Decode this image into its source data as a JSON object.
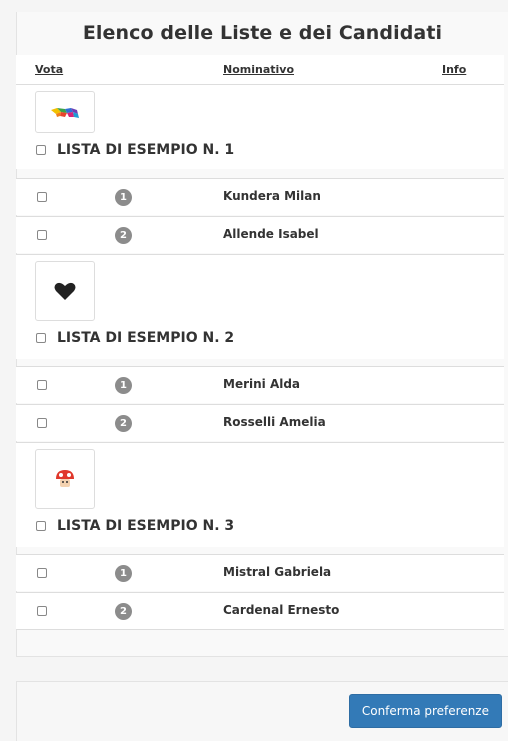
{
  "page": {
    "title": "Elenco delle Liste e dei Candidati"
  },
  "table": {
    "headers": {
      "vote": "Vota",
      "name": "Nominativo",
      "info": "Info"
    }
  },
  "lists": [
    {
      "title": "LISTA DI ESEMPIO N. 1",
      "logo_icon": "rainbow-horse-icon",
      "candidates": [
        {
          "number": "1",
          "name": "Kundera Milan"
        },
        {
          "number": "2",
          "name": "Allende Isabel"
        }
      ]
    },
    {
      "title": "LISTA DI ESEMPIO N. 2",
      "logo_icon": "black-heart-icon",
      "candidates": [
        {
          "number": "1",
          "name": "Merini Alda"
        },
        {
          "number": "2",
          "name": "Rosselli Amelia"
        }
      ]
    },
    {
      "title": "LISTA DI ESEMPIO N. 3",
      "logo_icon": "red-mushroom-icon",
      "candidates": [
        {
          "number": "1",
          "name": "Mistral Gabriela"
        },
        {
          "number": "2",
          "name": "Cardenal Ernesto"
        }
      ]
    }
  ],
  "footer": {
    "confirm_label": "Conferma preferenze"
  }
}
